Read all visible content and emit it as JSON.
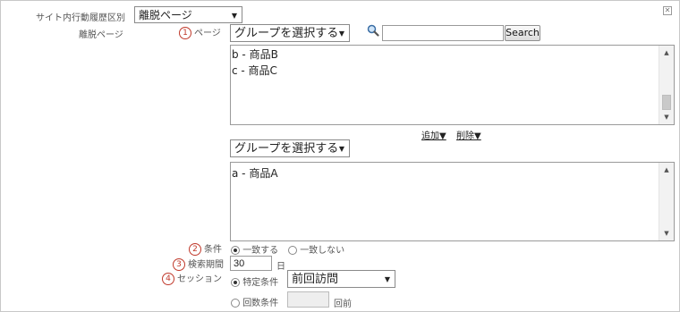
{
  "header": {
    "history_type_label": "サイト内行動履歴区別",
    "history_type_value": "離脱ページ",
    "close_icon": "close-icon"
  },
  "exit_page": {
    "section_label": "離脱ページ",
    "page_number": "1",
    "page_label": "ページ",
    "group_select_1": "グループを選択する",
    "search_placeholder": "",
    "search_button": "Search",
    "list_1_items": [
      "b - 商品B",
      "c - 商品C"
    ],
    "add_link": "追加▼",
    "delete_link": "削除▼",
    "group_select_2": "グループを選択する",
    "list_2_items": [
      "a - 商品A"
    ]
  },
  "condition": {
    "number": "2",
    "label": "条件",
    "option_match": "一致する",
    "option_nomatch": "一致しない",
    "selected": "match"
  },
  "period": {
    "number": "3",
    "label": "検索期間",
    "value": "30",
    "unit": "日"
  },
  "session": {
    "number": "4",
    "label": "セッション",
    "option_specific": "特定条件",
    "specific_value": "前回訪問",
    "option_count": "回数条件",
    "count_value": "",
    "count_unit": "回前"
  }
}
